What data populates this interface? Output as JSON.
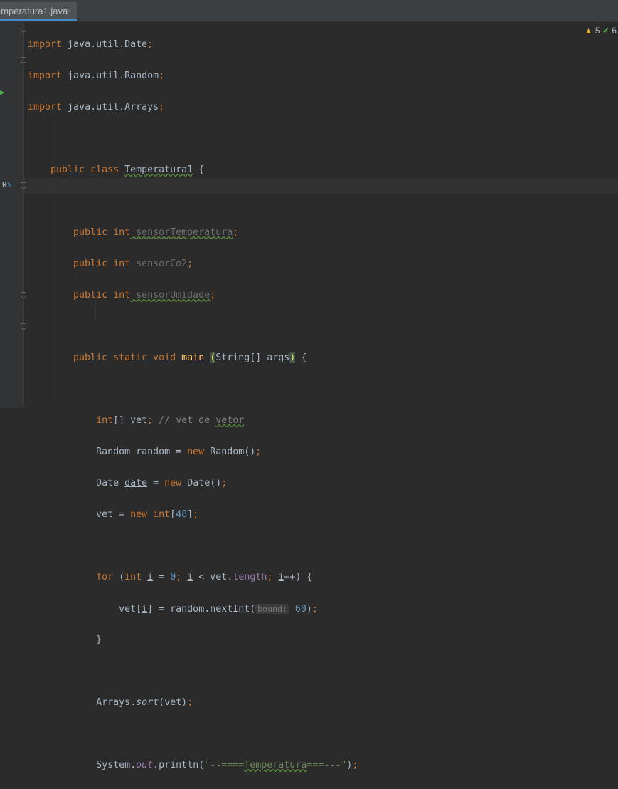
{
  "tab": {
    "title": "emperatura1.java",
    "close": "×"
  },
  "status": {
    "warnings": "5",
    "ok": "6"
  },
  "gutter": {
    "override_marker": "R"
  },
  "code": {
    "l1": [
      "import",
      " java.util.Date",
      ";"
    ],
    "l2": [
      "import",
      " java.util.Random",
      ";"
    ],
    "l3": [
      "import",
      " java.util.Arrays",
      ";"
    ],
    "l5": [
      "public class",
      " ",
      "Temperatura1",
      " {"
    ],
    "l7": [
      "public int",
      " sensorTemperatura",
      ";"
    ],
    "l8": [
      "public int",
      " sensorCo2",
      ";"
    ],
    "l9": [
      "public int",
      " sensorUmidade",
      ";"
    ],
    "l11": [
      "public static void",
      " ",
      "main",
      " ",
      "(",
      "String[] args",
      ")",
      " {"
    ],
    "l13": [
      "int",
      "[] vet",
      ";",
      " // vet de ",
      "vetor"
    ],
    "l14": [
      "Random random = ",
      "new",
      " Random()",
      ";"
    ],
    "l15": [
      "Date ",
      "date",
      " = ",
      "new",
      " Date()",
      ";"
    ],
    "l16": [
      "vet = ",
      "new int",
      "[",
      "48",
      "]",
      ";"
    ],
    "l18": [
      "for",
      " (",
      "int",
      " ",
      "i",
      " = ",
      "0",
      "; ",
      "i",
      " < vet.",
      "length",
      "; ",
      "i",
      "++) {"
    ],
    "l19": [
      "vet[",
      "i",
      "] = random.nextInt(",
      "bound:",
      " ",
      "60",
      ")",
      ";"
    ],
    "l20": [
      "}"
    ],
    "l22": [
      "Arrays.",
      "sort",
      "(vet)",
      ";"
    ],
    "l24": [
      "System.",
      "out",
      ".println(",
      "\"--====",
      "Temperatura",
      "===---\"",
      ")",
      ";"
    ]
  }
}
